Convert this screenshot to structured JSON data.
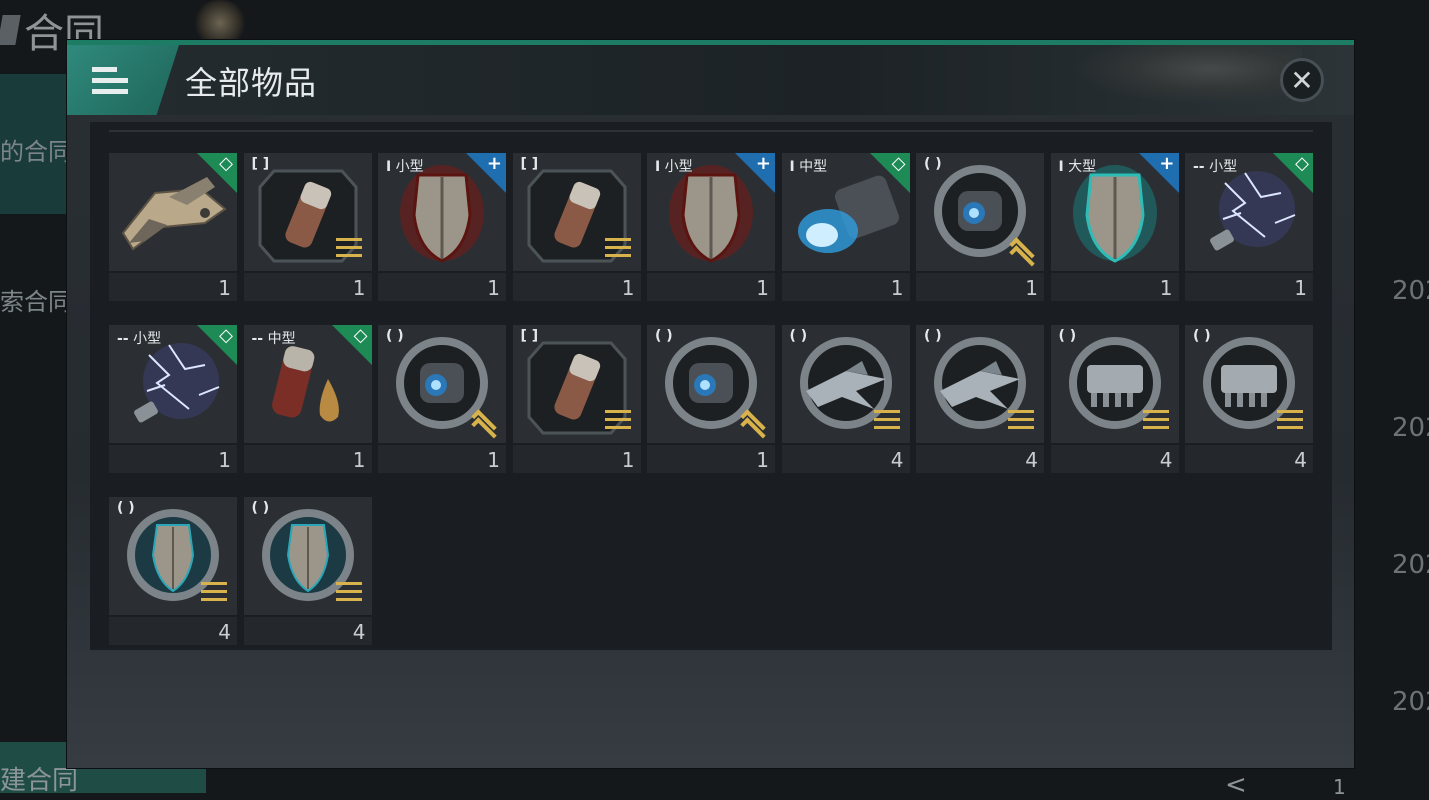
{
  "background": {
    "app_title": "合同",
    "side_texts": [
      "的合同",
      "索合同"
    ],
    "bottom_text": "建合同",
    "right_labels": [
      "202",
      "202",
      "202",
      "202"
    ],
    "page_number": "1",
    "nav_glyph": "<"
  },
  "modal": {
    "title": "全部物品",
    "close_glyph": "✕",
    "rows": [
      [
        {
          "tag": "",
          "size": "",
          "corner": "green",
          "corner_glyph": "◇",
          "icon": "ship-icon",
          "badge": "",
          "count": "1"
        },
        {
          "tag": "[ ]",
          "size": "",
          "corner": "",
          "corner_glyph": "",
          "icon": "canister-icon",
          "badge": "rank",
          "count": "1"
        },
        {
          "tag": "I",
          "size": "小型",
          "corner": "blue",
          "corner_glyph": "+",
          "icon": "red-shield-icon",
          "badge": "",
          "count": "1"
        },
        {
          "tag": "[ ]",
          "size": "",
          "corner": "",
          "corner_glyph": "",
          "icon": "canister-icon",
          "badge": "rank",
          "count": "1"
        },
        {
          "tag": "I",
          "size": "小型",
          "corner": "blue",
          "corner_glyph": "+",
          "icon": "red-shield-icon",
          "badge": "",
          "count": "1"
        },
        {
          "tag": "I",
          "size": "中型",
          "corner": "green",
          "corner_glyph": "◇",
          "icon": "thruster-icon",
          "badge": "",
          "count": "1"
        },
        {
          "tag": "( )",
          "size": "",
          "corner": "",
          "corner_glyph": "",
          "icon": "engine-ring-icon",
          "badge": "chevron",
          "count": "1"
        },
        {
          "tag": "I",
          "size": "大型",
          "corner": "blue",
          "corner_glyph": "+",
          "icon": "cyan-shield-icon",
          "badge": "",
          "count": "1"
        },
        {
          "tag": "--",
          "size": "小型",
          "corner": "green",
          "corner_glyph": "◇",
          "icon": "lightning-icon",
          "badge": "",
          "count": "1"
        }
      ],
      [
        {
          "tag": "--",
          "size": "小型",
          "corner": "green",
          "corner_glyph": "◇",
          "icon": "lightning-icon",
          "badge": "",
          "count": "1"
        },
        {
          "tag": "--",
          "size": "中型",
          "corner": "green",
          "corner_glyph": "◇",
          "icon": "fuel-drop-icon",
          "badge": "",
          "count": "1"
        },
        {
          "tag": "( )",
          "size": "",
          "corner": "",
          "corner_glyph": "",
          "icon": "engine-ring-icon",
          "badge": "chevron",
          "count": "1"
        },
        {
          "tag": "[ ]",
          "size": "",
          "corner": "",
          "corner_glyph": "",
          "icon": "canister-icon",
          "badge": "rank",
          "count": "1"
        },
        {
          "tag": "( )",
          "size": "",
          "corner": "",
          "corner_glyph": "",
          "icon": "engine-ring-icon",
          "badge": "chevron",
          "count": "1"
        },
        {
          "tag": "( )",
          "size": "",
          "corner": "",
          "corner_glyph": "",
          "icon": "fighter-ring-icon",
          "badge": "rank",
          "count": "4"
        },
        {
          "tag": "( )",
          "size": "",
          "corner": "",
          "corner_glyph": "",
          "icon": "fighter-ring-icon",
          "badge": "rank",
          "count": "4"
        },
        {
          "tag": "( )",
          "size": "",
          "corner": "",
          "corner_glyph": "",
          "icon": "turret-ring-icon",
          "badge": "rank",
          "count": "4"
        },
        {
          "tag": "( )",
          "size": "",
          "corner": "",
          "corner_glyph": "",
          "icon": "turret-ring-icon",
          "badge": "rank",
          "count": "4"
        }
      ],
      [
        {
          "tag": "( )",
          "size": "",
          "corner": "",
          "corner_glyph": "",
          "icon": "shield-ring-icon",
          "badge": "rank",
          "count": "4"
        },
        {
          "tag": "( )",
          "size": "",
          "corner": "",
          "corner_glyph": "",
          "icon": "shield-ring-icon",
          "badge": "rank",
          "count": "4"
        }
      ]
    ]
  },
  "colors": {
    "accent_teal": "#2f8a7c",
    "corner_green": "#1e8a56",
    "corner_blue": "#1e6eb0",
    "rank_gold": "#d8b24a"
  }
}
